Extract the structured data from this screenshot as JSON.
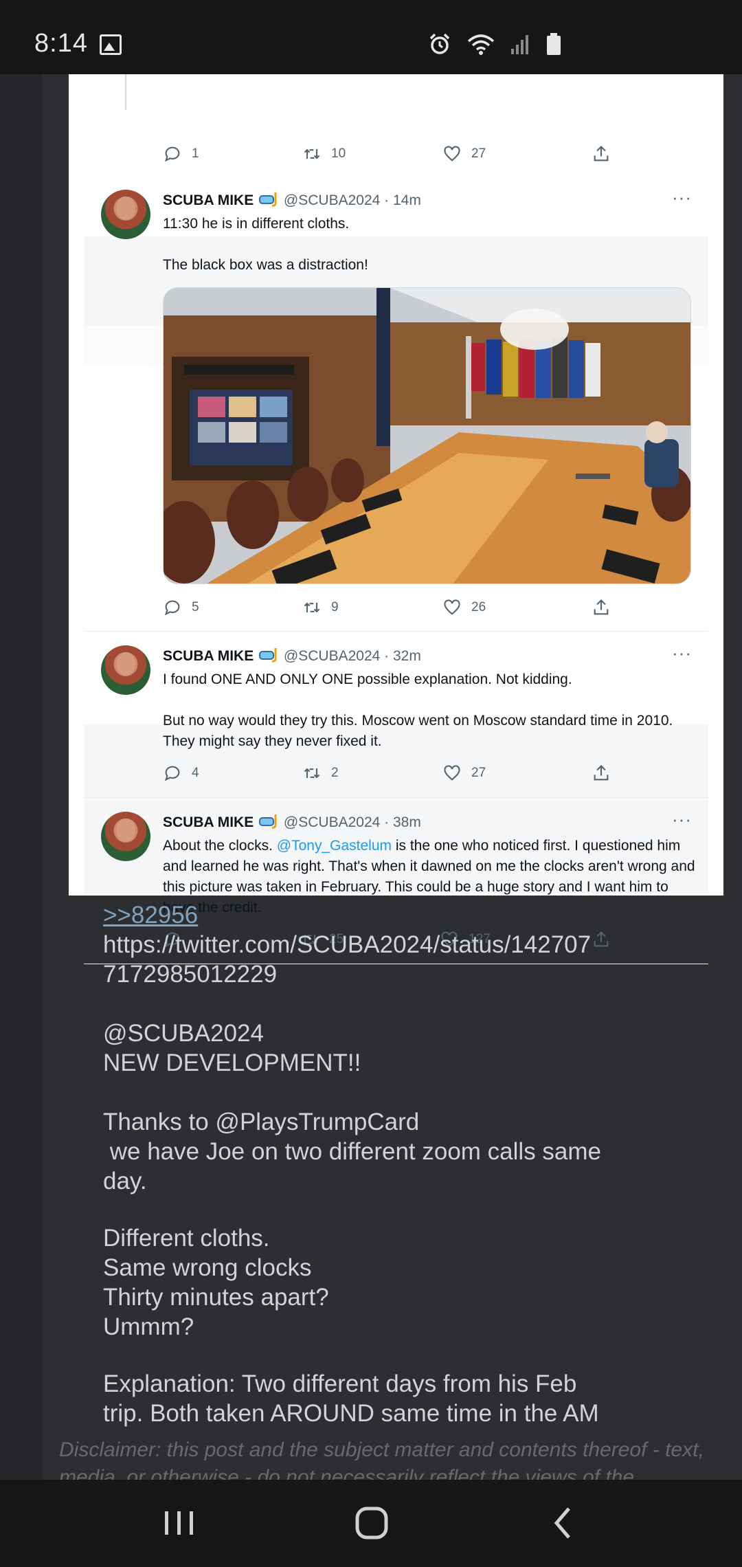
{
  "status_bar": {
    "time": "8:14",
    "icons": [
      "gallery-icon",
      "alarm-icon",
      "wifi-icon",
      "signal-icon",
      "battery-icon"
    ]
  },
  "embedded_screenshot": {
    "top_partial_actions": {
      "reply": "1",
      "retweet": "10",
      "like": "27"
    },
    "tweets": [
      {
        "name": "SCUBA MIKE",
        "handle": "@SCUBA2024",
        "time": "· 14m",
        "text_1": "11:30 he is in different cloths.",
        "text_2": "The black box was a distraction!",
        "has_image": true,
        "image_desc": "situation-room-photo",
        "actions": {
          "reply": "5",
          "retweet": "9",
          "like": "26"
        }
      },
      {
        "name": "SCUBA MIKE",
        "handle": "@SCUBA2024",
        "time": "· 32m",
        "text_1": "I found ONE AND ONLY ONE possible explanation. Not kidding.",
        "text_2": "But no way would they try this. Moscow went on Moscow standard time in 2010. They might say they never fixed it.",
        "actions": {
          "reply": "4",
          "retweet": "2",
          "like": "27"
        }
      },
      {
        "name": "SCUBA MIKE",
        "handle": "@SCUBA2024",
        "time": "· 38m",
        "text_prefix": "About the clocks. ",
        "mention": "@Tony_Gastelum",
        "text_suffix": " is the one who noticed first. I questioned him and learned he was right. That's when it dawned on me the clocks aren't wrong and this picture was taken in February. This could be a huge story and I want him to have the credit.",
        "actions": {
          "reply": "",
          "retweet": "25",
          "like": "127"
        }
      }
    ],
    "more_label": "···"
  },
  "post": {
    "reply_link": ">>82956",
    "url_line_1": "https://twitter.com/SCUBA2024/status/142707",
    "url_line_2": "7172985012229",
    "line_handle": "@SCUBA2024",
    "line_dev": "NEW DEVELOPMENT!!",
    "line_thanks": "Thanks to @PlaysTrumpCard",
    "line_joe_1": " we have Joe on two different zoom calls same",
    "line_joe_2": "day.",
    "line_cloths": "Different cloths.",
    "line_clocks": "Same wrong clocks",
    "line_thirty": "Thirty minutes apart?",
    "line_ummm": "Ummm?",
    "line_expl_1": "Explanation: Two different days from his Feb",
    "line_expl_2": "trip. Both taken AROUND same time in the AM",
    "disclaimer": "Disclaimer: this post and the subject matter and contents thereof - text, media, or otherwise - do not necessarily reflect the views of the"
  },
  "nav_bar": {
    "buttons": [
      "recents-button",
      "home-button",
      "back-button"
    ]
  }
}
